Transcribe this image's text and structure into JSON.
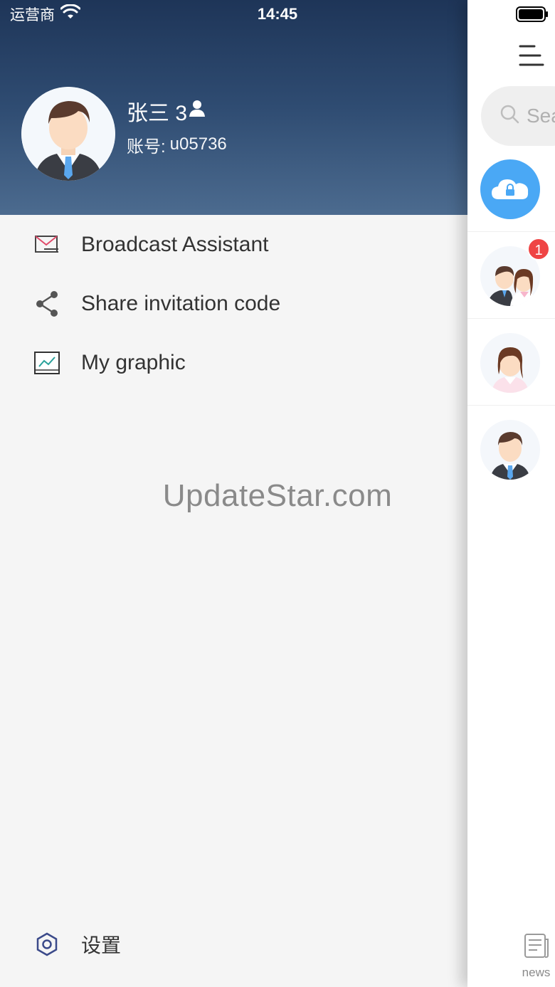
{
  "status_bar": {
    "carrier": "运营商",
    "time": "14:45"
  },
  "profile": {
    "name": "张三 3",
    "account_label": "账号:",
    "account_id": "u05736",
    "avatar_icon": "male-avatar-icon",
    "name_suffix_icon": "person-icon"
  },
  "menu": {
    "items": [
      {
        "label": "Broadcast Assistant",
        "icon": "mail-icon"
      },
      {
        "label": "Share invitation code",
        "icon": "share-icon"
      },
      {
        "label": "My graphic",
        "icon": "chart-image-icon"
      }
    ]
  },
  "watermark": "UpdateStar.com",
  "settings": {
    "label": "设置",
    "icon": "hexagon-settings-icon"
  },
  "main": {
    "search_placeholder": "Sea",
    "conversations": [
      {
        "avatar": "cloud-lock-icon",
        "badge": ""
      },
      {
        "avatar": "couple-avatar-icon",
        "badge": "1"
      },
      {
        "avatar": "female-avatar-icon",
        "badge": ""
      },
      {
        "avatar": "male-avatar-icon",
        "badge": ""
      }
    ],
    "bottom_tab_label": "news"
  },
  "colors": {
    "header_top": "#1e3558",
    "header_bottom": "#4c6b8f",
    "drawer_bg": "#f5f5f5",
    "badge": "#ef4444",
    "accent_blue": "#4aa8f5"
  }
}
